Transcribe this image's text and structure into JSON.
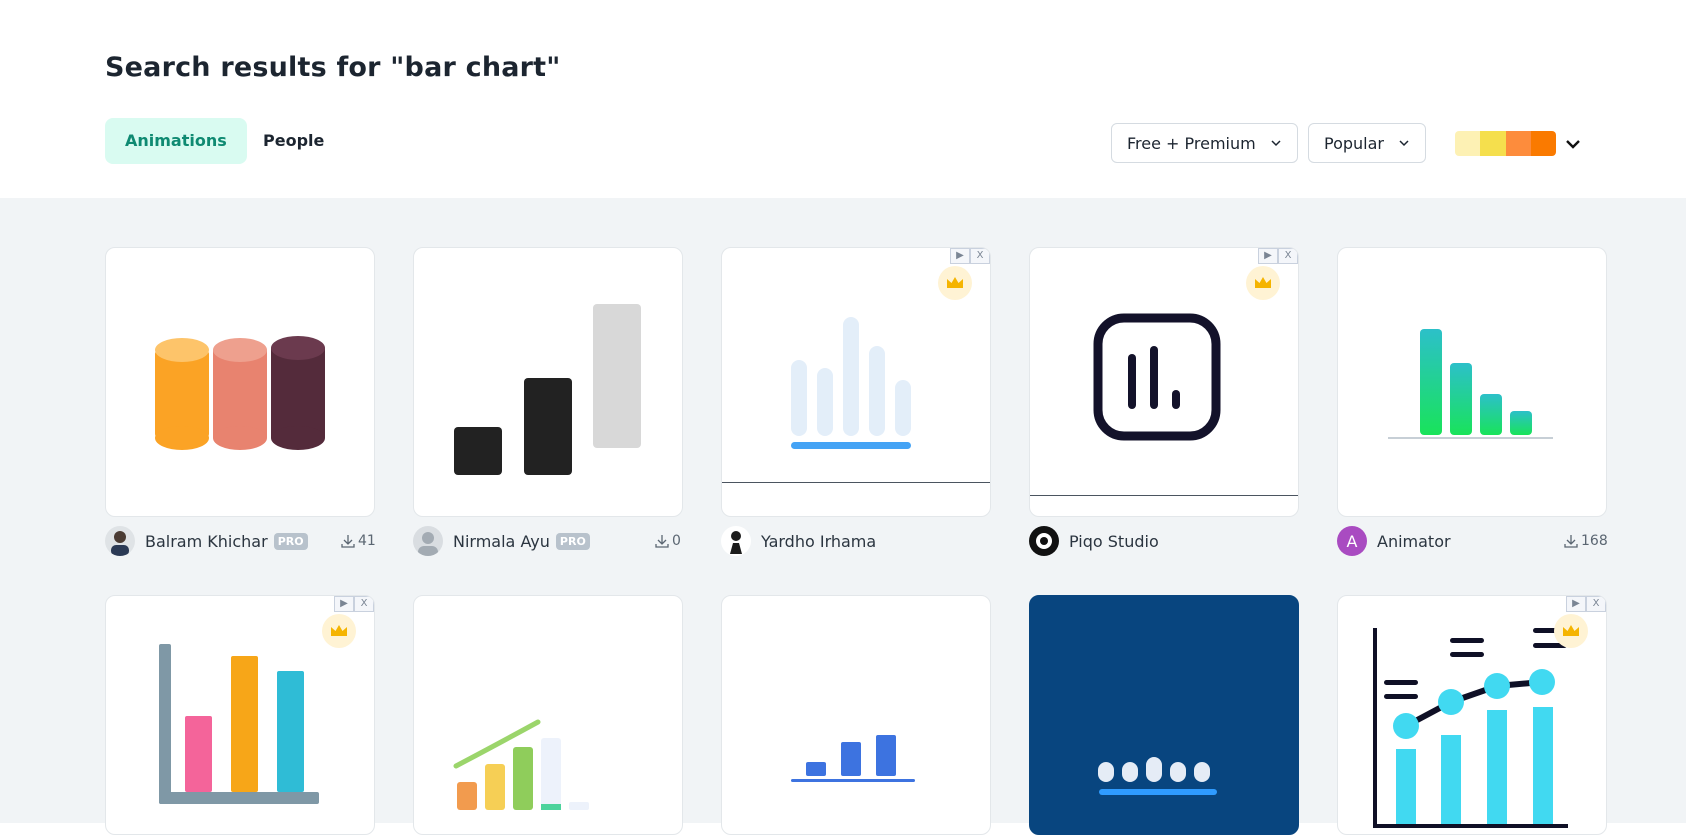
{
  "page_title": "Search results for \"bar chart\"",
  "tabs": [
    {
      "label": "Animations",
      "active": true
    },
    {
      "label": "People",
      "active": false
    }
  ],
  "filters": {
    "license": "Free + Premium",
    "sort": "Popular",
    "palette_colors": [
      "#fdf1b4",
      "#f5df4d",
      "#fd8c3c",
      "#fa7a00"
    ]
  },
  "cards": [
    {
      "author": "Balram Khichar",
      "pro": "PRO",
      "downloads": "41",
      "ad": false,
      "premium": false
    },
    {
      "author": "Nirmala Ayu",
      "pro": "PRO",
      "downloads": "0",
      "ad": false,
      "premium": false
    },
    {
      "author": "Yardho Irhama",
      "ad": true,
      "premium": true
    },
    {
      "author": "Piqo Studio",
      "ad": true,
      "premium": true
    },
    {
      "author": "Animator",
      "avatar_letter": "A",
      "downloads": "168",
      "ad": false,
      "premium": false
    },
    {
      "ad": true,
      "premium": true
    },
    {
      "ad": false,
      "premium": false
    },
    {
      "ad": false,
      "premium": false
    },
    {
      "ad": false,
      "premium": false
    },
    {
      "ad": true,
      "premium": true
    }
  ],
  "ad_icons": {
    "play": "▶",
    "close": "X"
  },
  "colors": {
    "accent": "#0f8a72",
    "accent_bg": "#d9fbf1",
    "crown": "#f5b400"
  }
}
